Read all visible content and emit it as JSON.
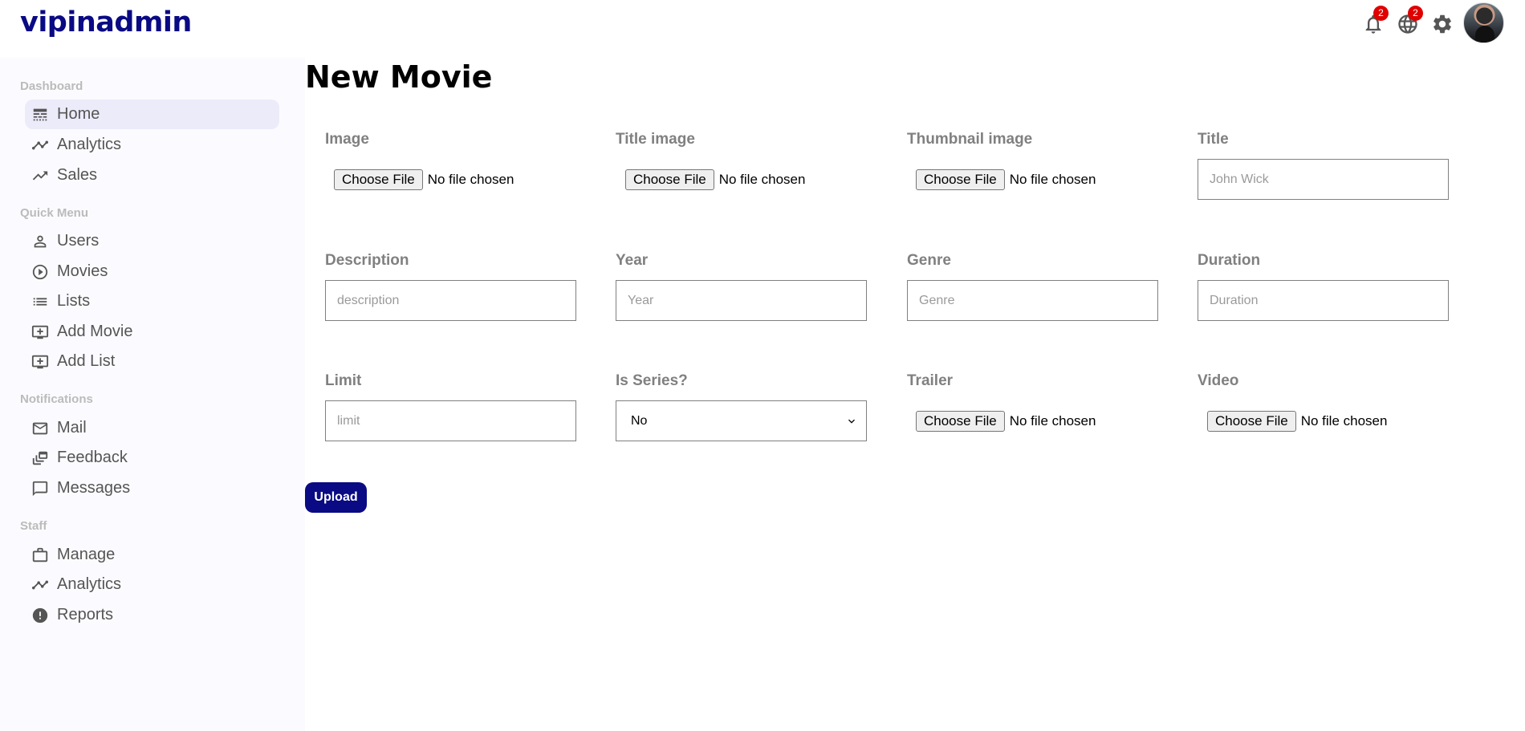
{
  "topbar": {
    "logo": "vipinadmin",
    "notifications_badge": "2",
    "language_badge": "2"
  },
  "sidebar": {
    "sections": [
      {
        "title": "Dashboard",
        "items": [
          {
            "label": "Home",
            "icon": "line-style-icon",
            "active": true
          },
          {
            "label": "Analytics",
            "icon": "timeline-icon"
          },
          {
            "label": "Sales",
            "icon": "trending-up-icon"
          }
        ]
      },
      {
        "title": "Quick Menu",
        "items": [
          {
            "label": "Users",
            "icon": "person-outline-icon"
          },
          {
            "label": "Movies",
            "icon": "play-circle-outline-icon"
          },
          {
            "label": "Lists",
            "icon": "list-icon"
          },
          {
            "label": "Add Movie",
            "icon": "add-to-queue-icon"
          },
          {
            "label": "Add List",
            "icon": "add-to-queue-icon"
          }
        ]
      },
      {
        "title": "Notifications",
        "items": [
          {
            "label": "Mail",
            "icon": "mail-outline-icon"
          },
          {
            "label": "Feedback",
            "icon": "dynamic-feed-icon"
          },
          {
            "label": "Messages",
            "icon": "chat-bubble-outline-icon"
          }
        ]
      },
      {
        "title": "Staff",
        "items": [
          {
            "label": "Manage",
            "icon": "work-outline-icon"
          },
          {
            "label": "Analytics",
            "icon": "timeline-icon"
          },
          {
            "label": "Reports",
            "icon": "report-icon"
          }
        ]
      }
    ]
  },
  "main": {
    "title": "New Movie",
    "fields": {
      "image": {
        "label": "Image",
        "button": "Choose File",
        "status": "No file chosen"
      },
      "title_image": {
        "label": "Title image",
        "button": "Choose File",
        "status": "No file chosen"
      },
      "thumbnail_image": {
        "label": "Thumbnail image",
        "button": "Choose File",
        "status": "No file chosen"
      },
      "title": {
        "label": "Title",
        "placeholder": "John Wick"
      },
      "description": {
        "label": "Description",
        "placeholder": "description"
      },
      "year": {
        "label": "Year",
        "placeholder": "Year"
      },
      "genre": {
        "label": "Genre",
        "placeholder": "Genre"
      },
      "duration": {
        "label": "Duration",
        "placeholder": "Duration"
      },
      "limit": {
        "label": "Limit",
        "placeholder": "limit"
      },
      "is_series": {
        "label": "Is Series?",
        "value": "No"
      },
      "trailer": {
        "label": "Trailer",
        "button": "Choose File",
        "status": "No file chosen"
      },
      "video": {
        "label": "Video",
        "button": "Choose File",
        "status": "No file chosen"
      }
    },
    "upload_label": "Upload"
  },
  "colors": {
    "brand": "#0a0a84",
    "badge": "#e00000",
    "sidebar_bg": "#fbfbff",
    "active_item_bg": "#ecebfa"
  }
}
